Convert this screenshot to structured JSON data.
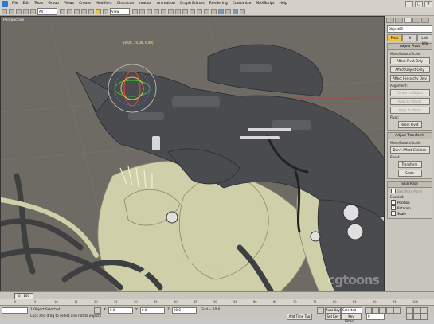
{
  "menu": {
    "items": [
      "File",
      "Edit",
      "Tools",
      "Group",
      "Views",
      "Create",
      "Modifiers",
      "Character",
      "reactor",
      "Animation",
      "Graph Editors",
      "Rendering",
      "Customize",
      "MAXScript",
      "Help"
    ],
    "window_controls": [
      "_",
      "□",
      "×"
    ]
  },
  "toolbar": {
    "selection_filter": "All",
    "ref_coord": "View"
  },
  "viewport": {
    "label": "Perspective",
    "coord_readout": "[0.00, 10.00, 0.00]",
    "watermark": "cgtoons"
  },
  "command_panel": {
    "object_name": "Object09",
    "subtabs": [
      "Pivot",
      "IK",
      "Link Info"
    ],
    "adjust_pivot": {
      "title": "Adjust Pivot",
      "group": "Move/Rotate/Scale:",
      "buttons": [
        "Affect Pivot Only",
        "Affect Object Only",
        "Affect Hierarchy Only"
      ]
    },
    "alignment": {
      "title": "Alignment:",
      "buttons": [
        "Center to Object",
        "Align to Object",
        "Align to World"
      ]
    },
    "pivot": {
      "title": "Pivot:",
      "buttons": [
        "Reset Pivot"
      ]
    },
    "adjust_transform": {
      "title": "Adjust Transform",
      "group": "Move/Rotate/Scale:",
      "buttons": [
        "Don't Affect Children"
      ],
      "reset_title": "Reset:",
      "reset_buttons": [
        "Transform",
        "Scale"
      ]
    },
    "skin_pose": {
      "title": "Skin Pose",
      "skin_pose_mode": "Skin Pose Mode",
      "enabled_label": "Enabled:",
      "checks": [
        "Position",
        "Rotation",
        "Scale"
      ]
    }
  },
  "timeline": {
    "frame": "0 / 100",
    "ticks": [
      "0",
      "5",
      "10",
      "15",
      "20",
      "25",
      "30",
      "35",
      "40",
      "45",
      "50",
      "55",
      "60",
      "65",
      "70",
      "75",
      "80",
      "85",
      "90",
      "95",
      "100"
    ]
  },
  "status": {
    "selection": "1 Object Selected",
    "prompt": "Click and drag to select and rotate objects",
    "x_label": "X:",
    "x_value": "0.0",
    "y_label": "Y:",
    "y_value": "0.0",
    "z_label": "Z:",
    "z_value": "90.0",
    "grid": "Grid = 10.0",
    "add_time_tag": "Add Time Tag",
    "auto_key": "Auto Key",
    "set_key": "Set Key",
    "selected": "Selected",
    "key_filters": "Key Filters...",
    "frame_field": "0"
  },
  "colors": {
    "viewport_bg": "#6d6b63",
    "creature_skin": "#cfcfaa",
    "armor": "#4a4b4e",
    "ui_gray": "#c8c5bc",
    "pivot_highlight": "#f1c24a"
  }
}
